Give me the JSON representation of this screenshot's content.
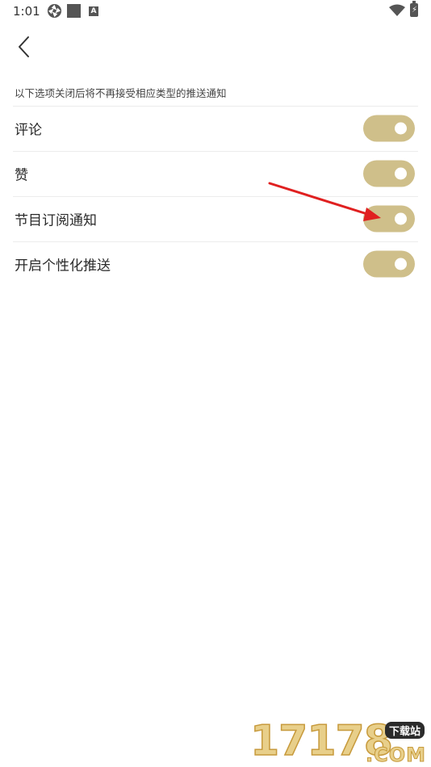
{
  "status_bar": {
    "time": "1:01",
    "icons": [
      "aperture-icon",
      "square-icon",
      "a-icon",
      "wifi-icon",
      "battery-icon"
    ],
    "a_icon_letter": "A"
  },
  "header": {
    "back_icon": "chevron-left-icon"
  },
  "hint_text": "以下选项关闭后将不再接受相应类型的推送通知",
  "settings": [
    {
      "label": "评论",
      "enabled": true
    },
    {
      "label": "赞",
      "enabled": true
    },
    {
      "label": "节目订阅通知",
      "enabled": true
    },
    {
      "label": "开启个性化推送",
      "enabled": true
    }
  ],
  "colors": {
    "toggle_on": "#cfbf8a",
    "annotation_arrow": "#e02020"
  },
  "watermark": {
    "digits": "17178",
    "badge": "下载站",
    "suffix": ".COM"
  }
}
